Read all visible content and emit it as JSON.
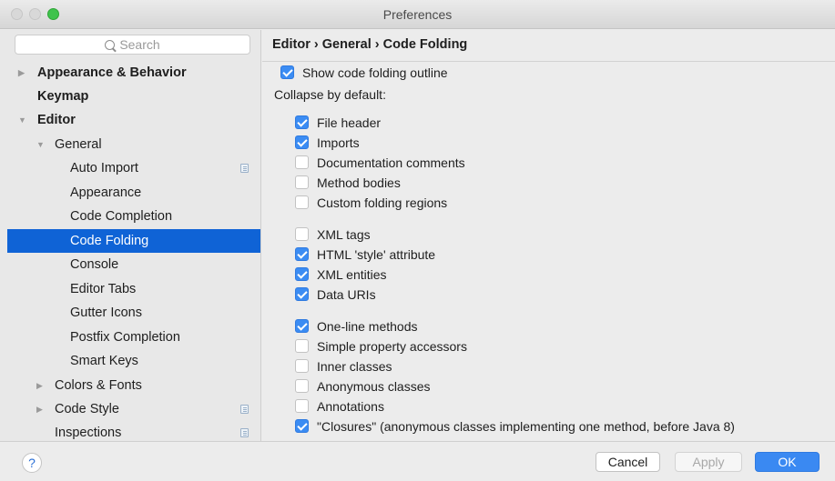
{
  "window": {
    "title": "Preferences"
  },
  "sidebar": {
    "search_placeholder": "Search",
    "items": [
      {
        "label": "Appearance & Behavior",
        "arrow": "▶"
      },
      {
        "label": "Keymap",
        "arrow": ""
      },
      {
        "label": "Editor",
        "arrow": "▼"
      },
      {
        "label": "General",
        "arrow": "▼"
      },
      {
        "label": "Auto Import",
        "arrow": ""
      },
      {
        "label": "Appearance",
        "arrow": ""
      },
      {
        "label": "Code Completion",
        "arrow": ""
      },
      {
        "label": "Code Folding",
        "arrow": ""
      },
      {
        "label": "Console",
        "arrow": ""
      },
      {
        "label": "Editor Tabs",
        "arrow": ""
      },
      {
        "label": "Gutter Icons",
        "arrow": ""
      },
      {
        "label": "Postfix Completion",
        "arrow": ""
      },
      {
        "label": "Smart Keys",
        "arrow": ""
      },
      {
        "label": "Colors & Fonts",
        "arrow": "▶"
      },
      {
        "label": "Code Style",
        "arrow": "▶"
      },
      {
        "label": "Inspections",
        "arrow": ""
      }
    ]
  },
  "main": {
    "breadcrumb": "Editor › General › Code Folding",
    "show_outline": {
      "label": "Show code folding outline",
      "checked": true
    },
    "collapse_heading": "Collapse by default:",
    "options": [
      {
        "label": "File header",
        "checked": true
      },
      {
        "label": "Imports",
        "checked": true
      },
      {
        "label": "Documentation comments",
        "checked": false
      },
      {
        "label": "Method bodies",
        "checked": false
      },
      {
        "label": "Custom folding regions",
        "checked": false
      },
      {
        "label": "XML tags",
        "checked": false
      },
      {
        "label": "HTML 'style' attribute",
        "checked": true
      },
      {
        "label": "XML entities",
        "checked": true
      },
      {
        "label": "Data URIs",
        "checked": true
      },
      {
        "label": "One-line methods",
        "checked": true
      },
      {
        "label": "Simple property accessors",
        "checked": false
      },
      {
        "label": "Inner classes",
        "checked": false
      },
      {
        "label": "Anonymous classes",
        "checked": false
      },
      {
        "label": "Annotations",
        "checked": false
      },
      {
        "label": "\"Closures\" (anonymous classes implementing one method, before Java 8)",
        "checked": true
      }
    ]
  },
  "footer": {
    "help_label": "?",
    "cancel_label": "Cancel",
    "apply_label": "Apply",
    "ok_label": "OK"
  },
  "colors": {
    "selection": "#0f63d6",
    "checkbox_on": "#3b8cf3",
    "ok_button": "#3a89f2"
  }
}
